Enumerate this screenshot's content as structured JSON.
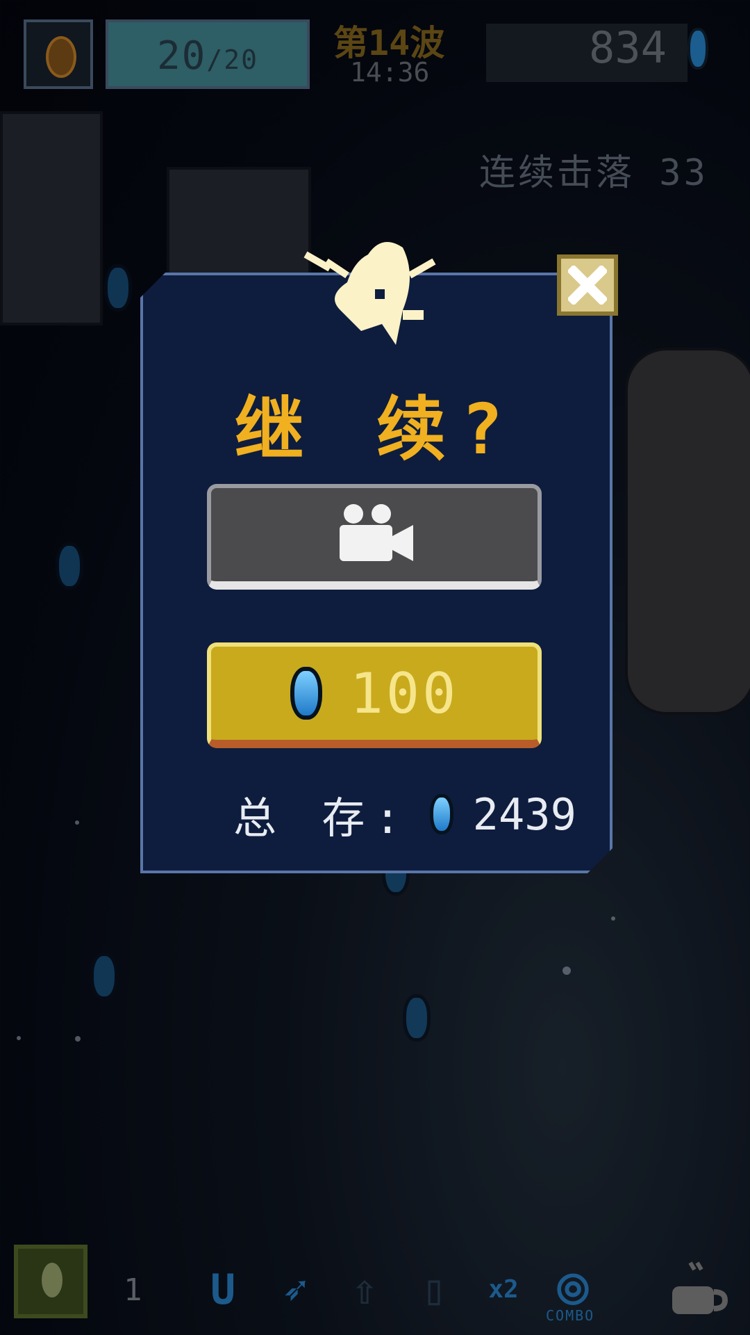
{
  "hud": {
    "health": "20",
    "health_max": "/20",
    "wave": "第14波",
    "time": "14:36",
    "score": "834",
    "combo_kills": "连续击落 33"
  },
  "dialog": {
    "title": "继 续?",
    "video_icon": "video-camera-icon",
    "gem_price": "100",
    "total_label": "总 存:",
    "total_gems": "2439",
    "close_icon": "close-icon"
  },
  "bottom_bar": {
    "bomb_count": "1",
    "powerups": [
      "magnet-icon",
      "wing-icon",
      "shield-up-icon",
      "tank-icon",
      "x2-icon",
      "combo-icon"
    ],
    "combo_label": "COMBO"
  },
  "colors": {
    "dialog_bg": "#0e1d3e",
    "title": "#f0b020",
    "gem_button": "#c8aa1c",
    "video_button": "#4b4b4d"
  }
}
